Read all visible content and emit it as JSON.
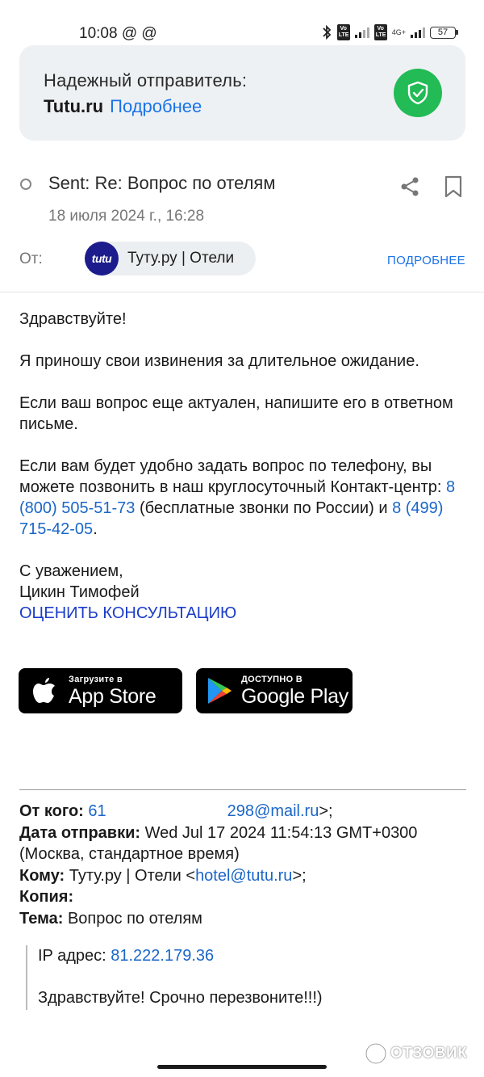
{
  "status_bar": {
    "time": "10:08",
    "at_icons": "@ @",
    "volte": "Vo LTE",
    "network": "4G+",
    "battery": "57"
  },
  "trusted": {
    "line1": "Надежный отправитель:",
    "brand": "Tutu.ru",
    "more": "Подробнее",
    "accent": "#22bb55"
  },
  "email": {
    "subject": "Sent: Re: Вопрос по отелям",
    "date": "18 июля 2024 г., 16:28",
    "from_label": "От:",
    "sender_avatar_text": "tutu",
    "sender_name": "Туту.ру | Отели",
    "details": "ПОДРОБНЕЕ"
  },
  "body": {
    "greeting": "Здравствуйте!",
    "apology": "Я приношу свои извинения за длительное ожидание.",
    "still_relevant": "Если ваш вопрос еще актуален, напишите его в ответном письме.",
    "phone_text_1": "Если вам будет удобно задать вопрос по телефону, вы можете позвонить в наш круглосуточный Контакт-центр: ",
    "phone_1": "8 (800) 505-51-73",
    "phone_text_2": " (бесплатные звонки по России) и ",
    "phone_2": "8 (499) 715-42-05",
    "phone_text_3": ".",
    "regards": "С уважением,",
    "signature": "Цикин Тимофей",
    "rate_link": "ОЦЕНИТЬ КОНСУЛЬТАЦИЮ"
  },
  "badges": {
    "appstore_small": "Загрузите в",
    "appstore_big": "App Store",
    "google_small": "ДОСТУПНО В",
    "google_big": "Google Play"
  },
  "quoted": {
    "from_label": "От кого:",
    "from_start": "61",
    "from_end": "298@mail.ru",
    "from_suffix": ">;",
    "date_label": "Дата отправки:",
    "date_value": "Wed Jul 17 2024 11:54:13 GMT+0300 (Москва, стандартное время)",
    "to_label": "Кому:",
    "to_name": "Туту.ру | Отели <",
    "to_email": "hotel@tutu.ru",
    "to_suffix": ">;",
    "cc_label": "Копия:",
    "subject_label": "Тема:",
    "subject_value": "Вопрос по отелям",
    "ip_label": "IP адрес: ",
    "ip_value": "81.222.179.36",
    "message": "Здравствуйте! Срочно перезвоните!!!)"
  },
  "watermark": "ОТЗОВИК"
}
